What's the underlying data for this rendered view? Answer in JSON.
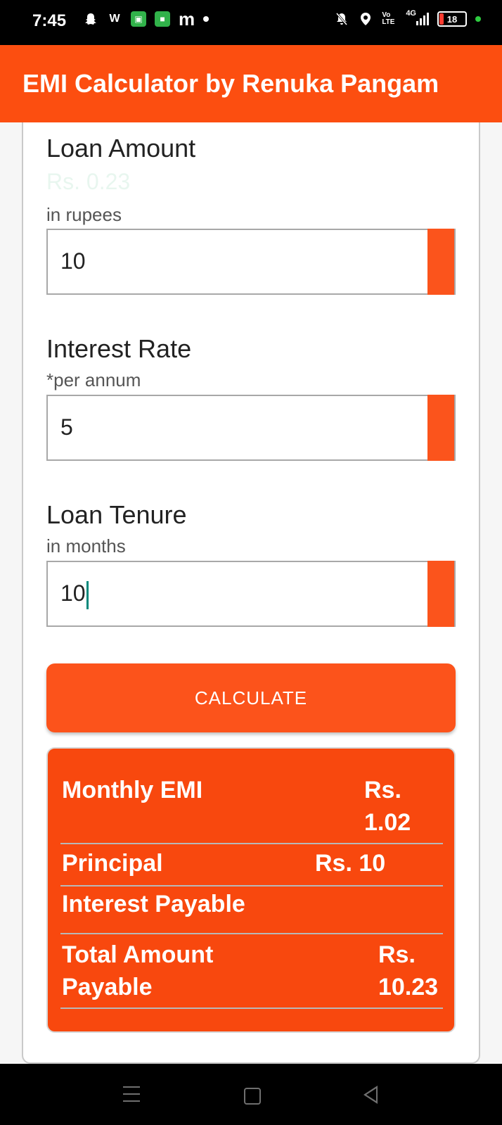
{
  "status_bar": {
    "time": "7:45",
    "network": "4G",
    "volte": "Vo LTE",
    "battery": "18"
  },
  "app_bar": {
    "title": "EMI Calculator by Renuka Pangam"
  },
  "loan_amount": {
    "label": "Loan Amount",
    "preview": "Rs. 0.23",
    "hint": "in rupees",
    "value": "10"
  },
  "interest_rate": {
    "label": "Interest Rate",
    "hint": "*per annum",
    "value": "5"
  },
  "loan_tenure": {
    "label": "Loan Tenure",
    "hint": "in months",
    "value": "10"
  },
  "calculate_button": {
    "label": "CALCULATE"
  },
  "results": {
    "monthly_emi_label": "Monthly EMI",
    "monthly_emi_value_line1": "Rs.",
    "monthly_emi_value_line2": "1.02",
    "principal_label": "Principal",
    "principal_value": "Rs. 10",
    "interest_label": "Interest Payable",
    "total_label_line1": "Total Amount",
    "total_label_line2": "Payable",
    "total_value_line1": "Rs.",
    "total_value_line2": "10.23"
  },
  "colors": {
    "accent": "#fc4e10",
    "result_bg": "#f8480e",
    "cursor": "#00897b"
  }
}
